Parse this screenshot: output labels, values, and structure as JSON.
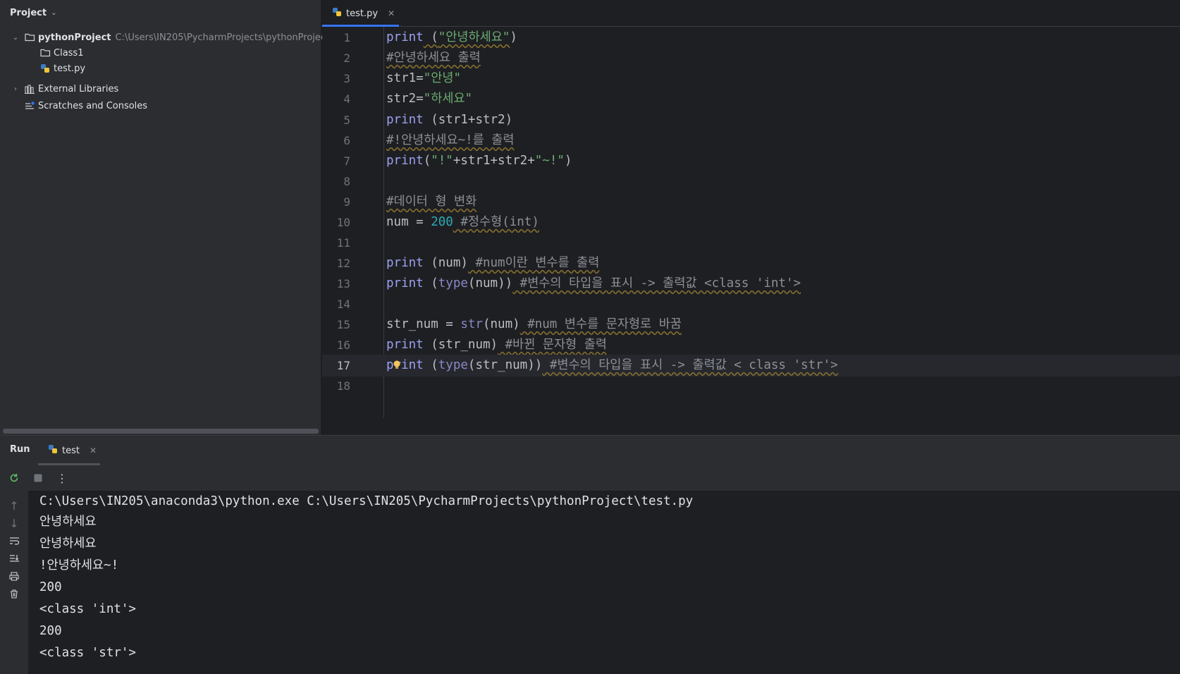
{
  "project_panel": {
    "title": "Project",
    "tree": [
      {
        "label": "pythonProject",
        "hint": "C:\\Users\\IN205\\PycharmProjects\\pythonProject",
        "icon": "folder-icon"
      },
      {
        "label": "Class1",
        "icon": "folder-icon"
      },
      {
        "label": "test.py",
        "icon": "python-file-icon"
      },
      {
        "label": "External Libraries",
        "icon": "library-icon"
      },
      {
        "label": "Scratches and Consoles",
        "icon": "scratches-icon"
      }
    ]
  },
  "editor": {
    "tab": "test.py",
    "current_line": 17,
    "line_numbers": [
      "1",
      "2",
      "3",
      "4",
      "5",
      "6",
      "7",
      "8",
      "9",
      "10",
      "11",
      "12",
      "13",
      "14",
      "15",
      "16",
      "17",
      "18"
    ],
    "lines": {
      "l1": {
        "a": "print",
        "b": " (",
        "c": "\"안녕하세요\"",
        "d": ")"
      },
      "l2": {
        "cmt": "#안녕하세요 출력"
      },
      "l3": {
        "a": "str1",
        "b": "=",
        "c": "\"안녕\""
      },
      "l4": {
        "a": "str2",
        "b": "=",
        "c": "\"하세요\""
      },
      "l5": {
        "a": "print",
        "b": " (str1+str2)"
      },
      "l6": {
        "cmt": "#!안녕하세요~!를 출력"
      },
      "l7": {
        "a": "print",
        "b": "(",
        "c": "\"!\"",
        "d": "+str1+str2+",
        "e": "\"~!\"",
        "f": ")"
      },
      "l9": {
        "cmt": "#데이터 형 변화"
      },
      "l10": {
        "a": "num = ",
        "b": "200",
        "cmt": " #정수형(int)"
      },
      "l12": {
        "a": "print",
        "b": " (num)",
        "cmt": " #num이란 변수를 출력"
      },
      "l13": {
        "a": "print",
        "b": " (",
        "c": "type",
        "d": "(num))",
        "cmt": " #변수의 타입을 표시 -> 출력값 <class 'int'>"
      },
      "l15": {
        "a": "str_num = ",
        "b": "str",
        "c": "(num)",
        "cmt": " #num 변수를 문자형로 바꿈"
      },
      "l16": {
        "a": "print",
        "b": " (str_num)",
        "cmt": " #바뀐 문자형 출력"
      },
      "l17": {
        "a": "print",
        "b": " (",
        "c": "type",
        "d": "(str_num))",
        "cmt": " #변수의 타입을 표시 -> 출력값 < class 'str'>"
      }
    }
  },
  "run_window": {
    "title": "Run",
    "tab": "test",
    "output": [
      "C:\\Users\\IN205\\anaconda3\\python.exe C:\\Users\\IN205\\PycharmProjects\\pythonProject\\test.py",
      "안녕하세요",
      "안녕하세요",
      "!안녕하세요~!",
      "200",
      "<class 'int'>",
      "200",
      "<class 'str'>"
    ]
  },
  "colors": {
    "background": "#1e1f22",
    "panel": "#2b2d30",
    "keyword": "#9aa2f1",
    "string": "#6aab73",
    "number": "#2aacb8",
    "comment": "#8c8f96",
    "accent": "#3574f0"
  }
}
